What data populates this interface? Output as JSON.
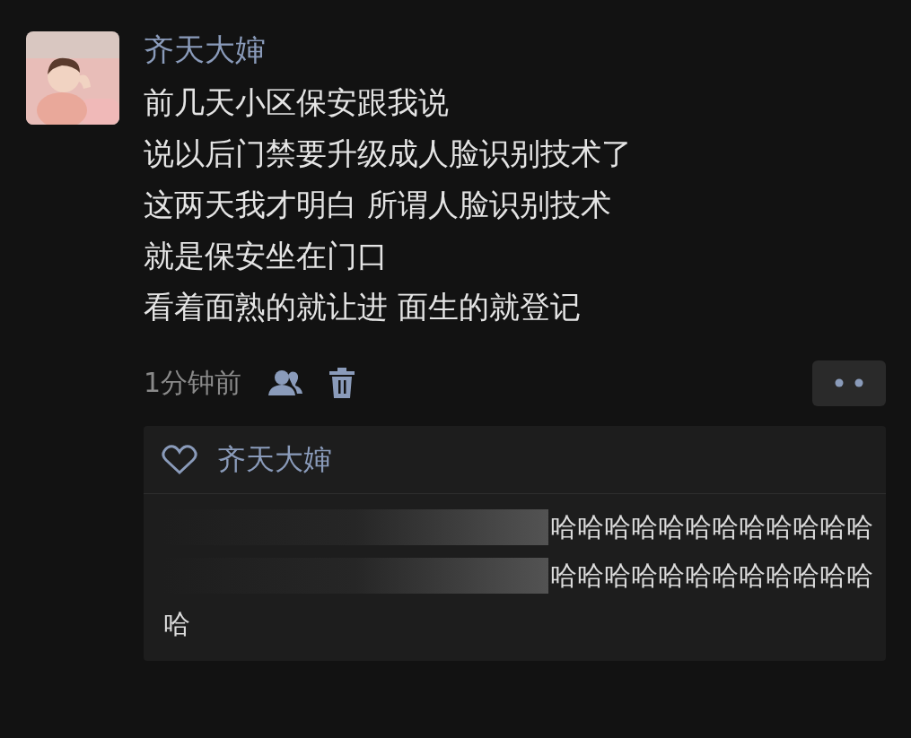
{
  "post": {
    "author": "齐天大婶",
    "lines": [
      "前几天小区保安跟我说",
      "说以后门禁要升级成人脸识别技术了",
      "这两天我才明白 所谓人脸识别技术",
      "就是保安坐在门口",
      "看着面熟的就让进 面生的就登记"
    ],
    "time": "1分钟前"
  },
  "likes": [
    "齐天大婶"
  ],
  "comment": {
    "lines": [
      "哈哈哈哈哈哈哈哈哈哈哈哈",
      "哈哈哈哈哈哈哈哈哈哈哈哈",
      "哈"
    ]
  }
}
